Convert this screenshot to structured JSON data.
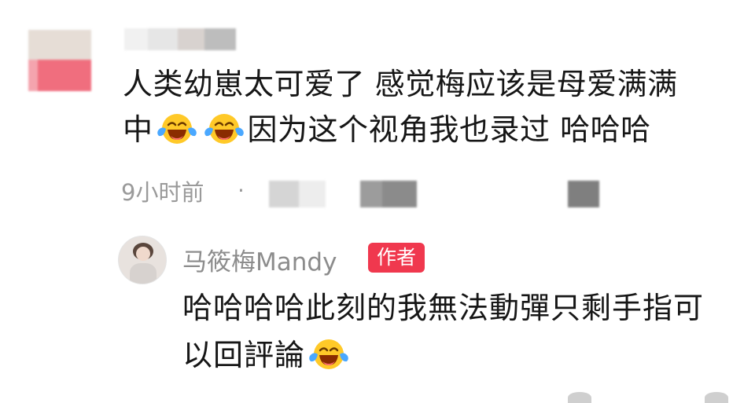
{
  "comment": {
    "avatar_colors": [
      "#e6ddd6",
      "#f06e7e"
    ],
    "text_line1": "人类幼崽太可爱了  感觉梅应该是母爱满满",
    "text_line2_a": "中",
    "text_line2_b": "因为这个视角我也录过 哈哈哈",
    "time": "9小时前",
    "separator": "·",
    "emoji": "laughing-crying-emoji"
  },
  "reply": {
    "username": "马筱梅Mandy",
    "badge": "作者",
    "text_line1": "哈哈哈哈此刻的我無法動彈只剩手指可",
    "text_line2": "以回評論",
    "emoji": "laughing-crying-emoji"
  },
  "colors": {
    "text": "#161616",
    "meta": "#9a9a9a",
    "badge_bg": "#f0384e",
    "badge_text": "#ffffff"
  }
}
